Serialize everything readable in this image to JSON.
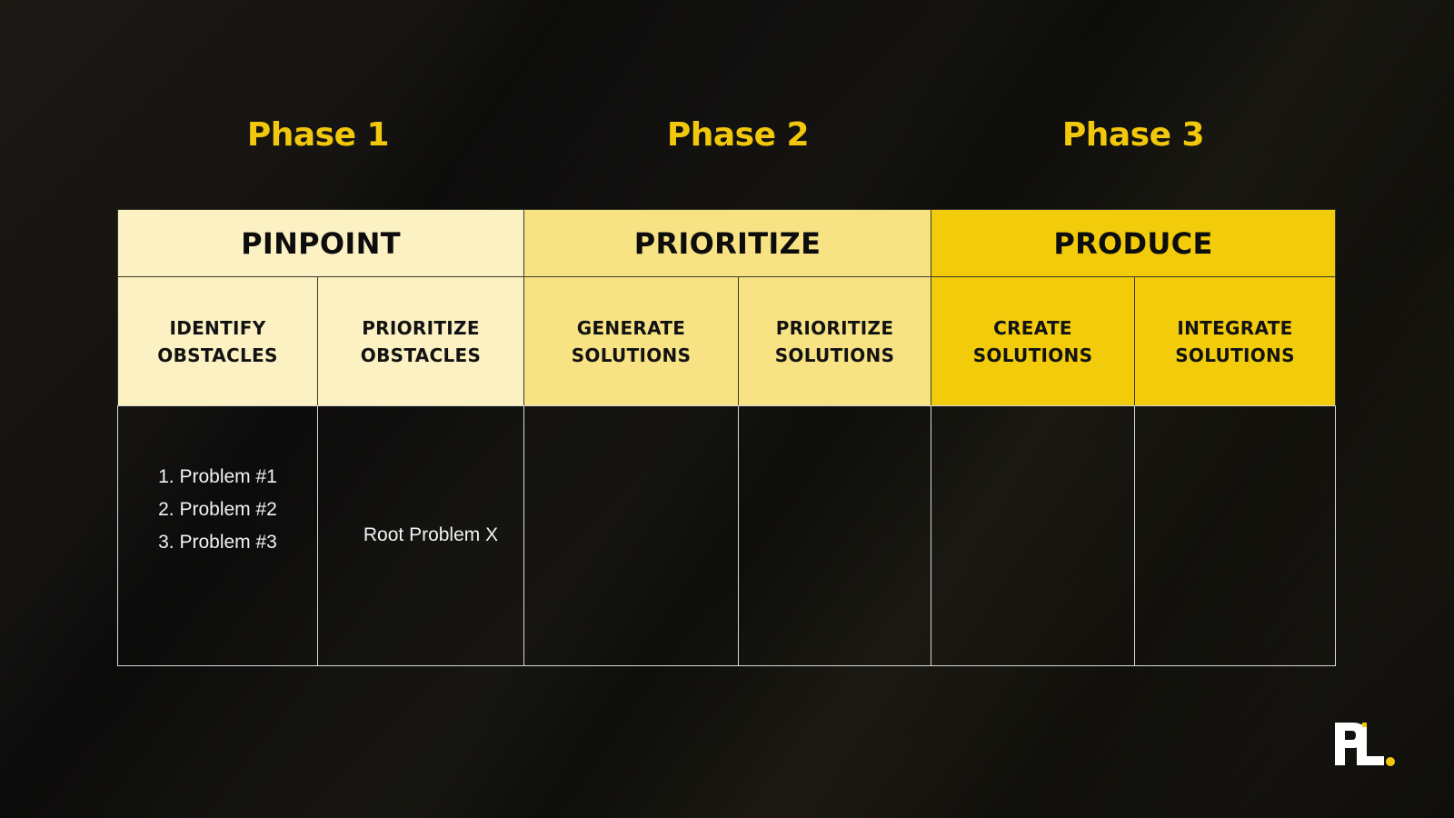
{
  "phases": [
    {
      "title": "Phase 1",
      "header": "PINPOINT",
      "color": "#fcf1c2",
      "steps": [
        {
          "label_line1": "IDENTIFY",
          "label_line2": "OBSTACLES"
        },
        {
          "label_line1": "PRIORITIZE",
          "label_line2": "OBSTACLES"
        }
      ]
    },
    {
      "title": "Phase 2",
      "header": "PRIORITIZE",
      "color": "#f8e384",
      "steps": [
        {
          "label_line1": "GENERATE",
          "label_line2": "SOLUTIONS"
        },
        {
          "label_line1": "PRIORITIZE",
          "label_line2": "SOLUTIONS"
        }
      ]
    },
    {
      "title": "Phase 3",
      "header": "PRODUCE",
      "color": "#f2cb0b",
      "steps": [
        {
          "label_line1": "CREATE",
          "label_line2": "SOLUTIONS"
        },
        {
          "label_line1": "INTEGRATE",
          "label_line2": "SOLUTIONS"
        }
      ]
    }
  ],
  "content": {
    "identify_obstacles": [
      "1. Problem #1",
      "2. Problem #2",
      "3. Problem #3"
    ],
    "prioritize_obstacles": "Root Problem X"
  },
  "logo": {
    "text": "PL",
    "accent": "#f2c80c"
  },
  "colors": {
    "accent": "#f2c80c",
    "background": "#141310"
  }
}
